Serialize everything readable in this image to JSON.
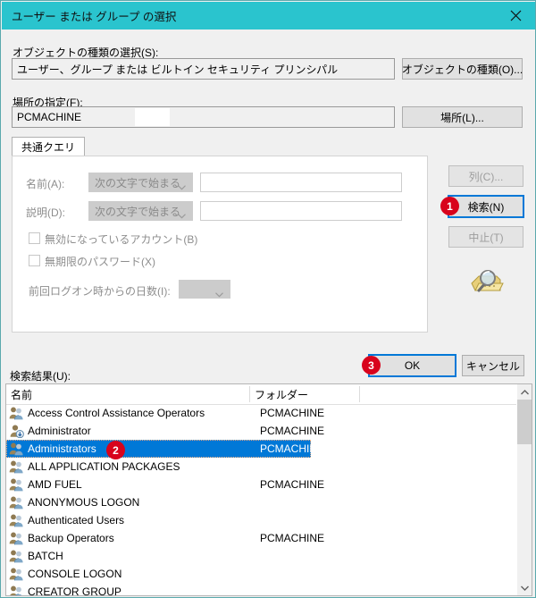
{
  "window": {
    "title": "ユーザー または グループ の選択",
    "close_label": "×",
    "titlebar_color": "#2ac4ce",
    "accent_color": "#0078d7",
    "badge_color": "#d8031c"
  },
  "object_type": {
    "label": "オブジェクトの種類の選択(S):",
    "value": "ユーザー、グループ または ビルトイン セキュリティ プリンシパル",
    "button_label": "オブジェクトの種類(O)..."
  },
  "location": {
    "label": "場所の指定(F):",
    "value": "PCMACHINE",
    "button_label": "場所(L)..."
  },
  "tabs": [
    {
      "label": "共通クエリ",
      "selected": true
    }
  ],
  "query": {
    "name": {
      "label": "名前(A):",
      "condition": "次の文字で始まる",
      "value": "",
      "disabled": true
    },
    "description": {
      "label": "説明(D):",
      "condition": "次の文字で始まる",
      "value": "",
      "disabled": true
    },
    "disabled_accounts": {
      "label": "無効になっているアカウント(B)",
      "checked": false,
      "disabled": true
    },
    "non_expiring_password": {
      "label": "無期限のパスワード(X)",
      "checked": false,
      "disabled": true
    },
    "days_since_logon": {
      "label": "前回ログオン時からの日数(I):",
      "value": "",
      "disabled": true
    }
  },
  "side_buttons": {
    "columns": {
      "label": "列(C)...",
      "disabled": true
    },
    "search": {
      "label": "検索(N)",
      "disabled": false,
      "focused": true
    },
    "stop": {
      "label": "中止(T)",
      "disabled": true
    }
  },
  "dialog_buttons": {
    "ok": {
      "label": "OK",
      "focused": true
    },
    "cancel": {
      "label": "キャンセル",
      "focused": false
    }
  },
  "results": {
    "label": "検索結果(U):",
    "columns": [
      "名前",
      "フォルダー"
    ],
    "rows": [
      {
        "name": "Access Control Assistance Operators",
        "folder": "PCMACHINE",
        "icon": "group-icon",
        "selected": false
      },
      {
        "name": "Administrator",
        "folder": "PCMACHINE",
        "icon": "user-icon",
        "selected": false
      },
      {
        "name": "Administrators",
        "folder": "PCMACHINE",
        "icon": "group-icon",
        "selected": true
      },
      {
        "name": "ALL APPLICATION PACKAGES",
        "folder": "",
        "icon": "group-icon",
        "selected": false
      },
      {
        "name": "AMD FUEL",
        "folder": "PCMACHINE",
        "icon": "group-icon",
        "selected": false
      },
      {
        "name": "ANONYMOUS LOGON",
        "folder": "",
        "icon": "group-icon",
        "selected": false
      },
      {
        "name": "Authenticated Users",
        "folder": "",
        "icon": "group-icon",
        "selected": false
      },
      {
        "name": "Backup Operators",
        "folder": "PCMACHINE",
        "icon": "group-icon",
        "selected": false
      },
      {
        "name": "BATCH",
        "folder": "",
        "icon": "group-icon",
        "selected": false
      },
      {
        "name": "CONSOLE LOGON",
        "folder": "",
        "icon": "group-icon",
        "selected": false
      },
      {
        "name": "CREATOR GROUP",
        "folder": "",
        "icon": "group-icon",
        "selected": false
      }
    ]
  },
  "badges": [
    {
      "number": "1",
      "target": "search-button"
    },
    {
      "number": "2",
      "target": "selected-result-row"
    },
    {
      "number": "3",
      "target": "ok-button"
    }
  ]
}
